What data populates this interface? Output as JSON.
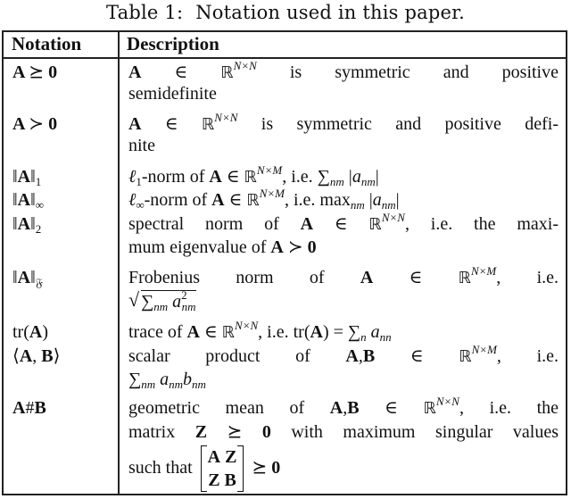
{
  "caption": {
    "label": "Table 1:",
    "text": "Notation used in this paper."
  },
  "header": {
    "notation": "Notation",
    "description": "Description"
  },
  "rows": [
    {
      "notation": "A ⪰ 0",
      "description_lines": [
        "A ∈ ℝ^{N×N} is symmetric and positive",
        "semidefinite"
      ]
    },
    {
      "notation": "A ≻ 0",
      "description_lines": [
        "A ∈ ℝ^{N×N} is symmetric and positive defi-",
        "nite"
      ]
    },
    {
      "notation": "‖A‖₁",
      "description_lines": [
        "ℓ₁-norm of A ∈ ℝ^{N×M}, i.e. Σ_{nm} |a_{nm}|"
      ]
    },
    {
      "notation": "‖A‖∞",
      "description_lines": [
        "ℓ∞-norm of A ∈ ℝ^{N×M}, i.e. max_{nm} |a_{nm}|"
      ]
    },
    {
      "notation": "‖A‖₂",
      "description_lines": [
        "spectral norm of A ∈ ℝ^{N×N}, i.e. the maxi-",
        "mum eigenvalue of A ≻ 0"
      ]
    },
    {
      "notation": "‖A‖𝔉",
      "description_lines": [
        "Frobenius norm of A ∈ ℝ^{N×M}, i.e.",
        "√(Σ_{nm} a²_{nm})"
      ]
    },
    {
      "notation": "tr(A)",
      "description_lines": [
        "trace of A ∈ ℝ^{N×N}, i.e. tr(A) = Σ_n a_{nn}"
      ]
    },
    {
      "notation": "⟨A, B⟩",
      "description_lines": [
        "scalar product of A, B ∈ ℝ^{N×M}, i.e.",
        "Σ_{nm} a_{nm} b_{nm}"
      ]
    },
    {
      "notation": "A#B",
      "description_lines": [
        "geometric mean of A, B ∈ ℝ^{N×N}, i.e. the",
        "matrix Z ⪰ 0 with maximum singular values",
        "such that [A Z; Z B] ⪰ 0"
      ]
    }
  ],
  "t": {
    "A": "A",
    "B": "B",
    "Z": "Z",
    "zero": "0",
    "R": "ℝ",
    "in": "∈",
    "succeq": "⪰",
    "succ": "≻",
    "norm": "‖",
    "NxN": "N×N",
    "NxM": "N×M",
    "sub1": "1",
    "subinf": "∞",
    "sub2": "2",
    "subF": "𝔉",
    "ell": "ℓ",
    "sum": "∑",
    "nm": "nm",
    "n": "n",
    "a": "a",
    "b": "b",
    "nn": "nn",
    "sq": "2",
    "comma": ",",
    "hash": "#",
    "tr": "tr",
    "lpar": "(",
    "rpar": ")",
    "langle": "⟨",
    "rangle": "⟩",
    "eq": "=",
    "max": "max",
    "bar": "|",
    "w_is_sym_pos": "is symmetric and positive",
    "w_semidefinite": "semidefinite",
    "w_is_sym_pos_defi": "is symmetric and positive defi-",
    "w_nite": "nite",
    "w_norm_of": "-norm of",
    "w_ie": ", i.e.",
    "w_spectral": "spectral norm of",
    "w_the_maxi": ", i.e. the maxi-",
    "w_mum_eig": "mum eigenvalue of",
    "w_frob": "Frobenius norm of",
    "w_ie2": "i.e.",
    "w_trace": "trace of",
    "w_scalar": "scalar product of",
    "w_geo": "geometric mean of",
    "w_ie_the": ", i.e. the",
    "w_matrix": "matrix",
    "w_with_max": "with maximum singular values",
    "w_such_that": "such that"
  }
}
